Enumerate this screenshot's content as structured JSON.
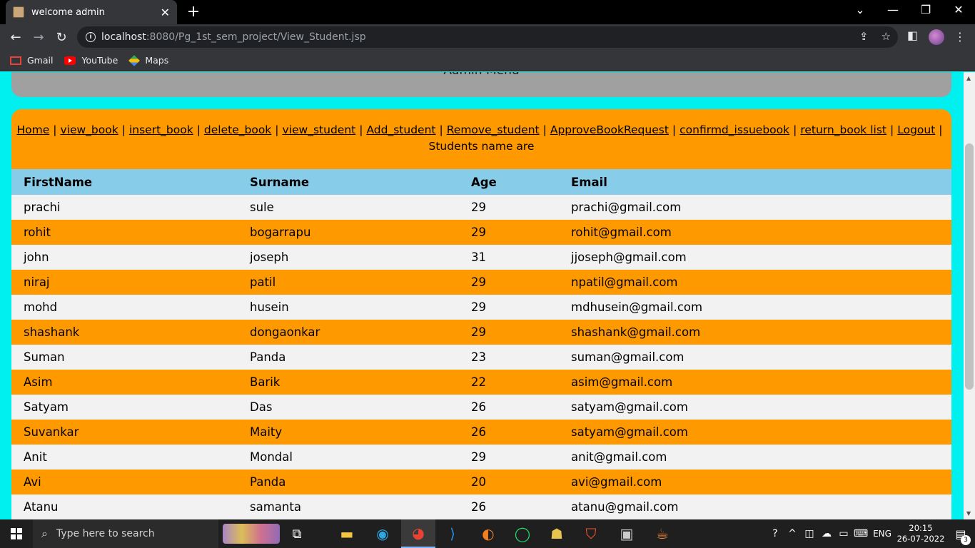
{
  "browser": {
    "tab_title": "welcome admin",
    "tab_close": "✕",
    "new_tab": "+",
    "url_host": "localhost",
    "url_rest": ":8080/Pg_1st_sem_project/View_Student.jsp",
    "bookmarks": [
      {
        "label": "Gmail",
        "icon": "gmail-icon"
      },
      {
        "label": "YouTube",
        "icon": "youtube-icon"
      },
      {
        "label": "Maps",
        "icon": "maps-icon"
      }
    ]
  },
  "page": {
    "header_text": "Admin Menu",
    "menu": {
      "home": "Home",
      "view_book": "view_book",
      "insert_book": "insert_book",
      "delete_book": "delete_book",
      "view_student": "view_student",
      "add_student": "Add_student",
      "remove_student": "Remove_student",
      "approve": "ApproveBookRequest",
      "confirmed": "confirmd_issuebook",
      "return_list": "return_book list",
      "logout": "Logout",
      "separator": "|"
    },
    "caption": "Students name are",
    "table": {
      "headers": [
        "FirstName",
        "Surname",
        "Age",
        "Email"
      ],
      "rows": [
        [
          "prachi",
          "sule",
          "29",
          "prachi@gmail.com"
        ],
        [
          "rohit",
          "bogarrapu",
          "29",
          "rohit@gmail.com"
        ],
        [
          "john",
          "joseph",
          "31",
          "jjoseph@gmail.com"
        ],
        [
          "niraj",
          "patil",
          "29",
          "npatil@gmail.com"
        ],
        [
          "mohd",
          "husein",
          "29",
          "mdhusein@gmail.com"
        ],
        [
          "shashank",
          "dongaonkar",
          "29",
          "shashank@gmail.com"
        ],
        [
          "Suman",
          "Panda",
          "23",
          "suman@gmail.com"
        ],
        [
          "Asim",
          "Barik",
          "22",
          "asim@gmail.com"
        ],
        [
          "Satyam",
          "Das",
          "26",
          "satyam@gmail.com"
        ],
        [
          "Suvankar",
          "Maity",
          "26",
          "satyam@gmail.com"
        ],
        [
          "Anit",
          "Mondal",
          "29",
          "anit@gmail.com"
        ],
        [
          "Avi",
          "Panda",
          "20",
          "avi@gmail.com"
        ],
        [
          "Atanu",
          "samanta",
          "26",
          "atanu@gmail.com"
        ]
      ]
    }
  },
  "taskbar": {
    "search_placeholder": "Type here to search",
    "language": "ENG",
    "time": "20:15",
    "date": "26-07-2022",
    "notification_count": "3"
  }
}
